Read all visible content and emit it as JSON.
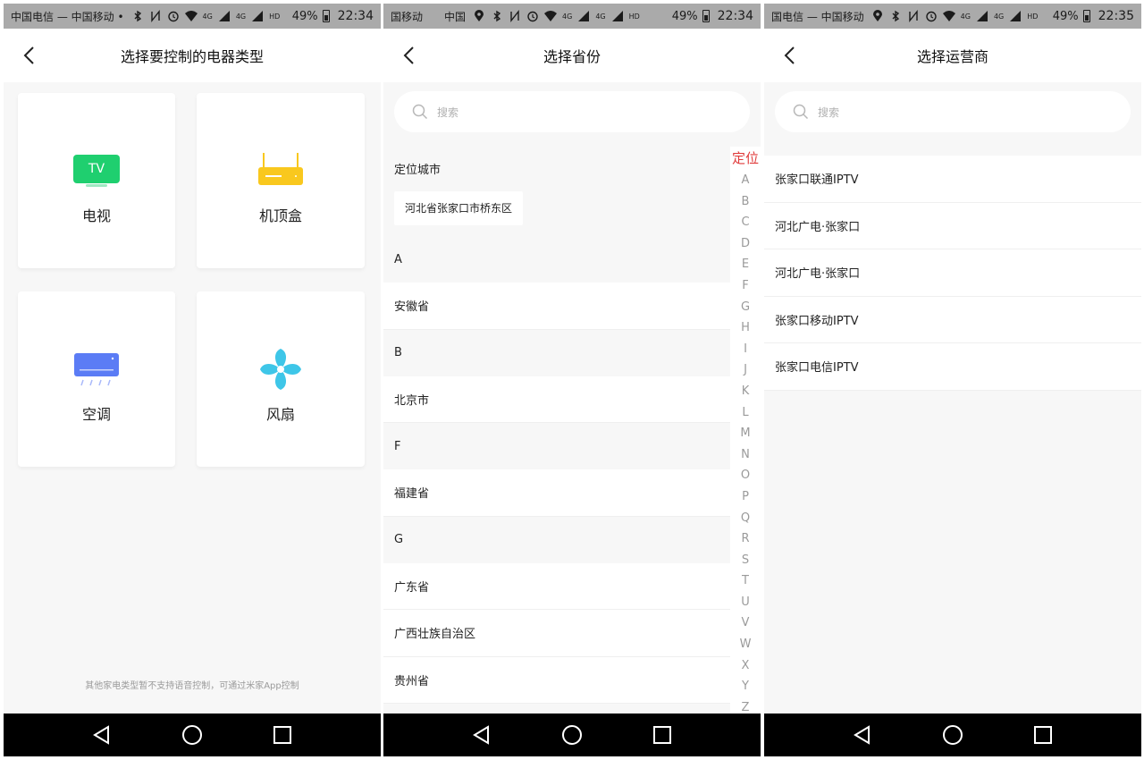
{
  "colors": {
    "statusbar_bg": "#aaaaaa",
    "tv_green": "#1fcf6f",
    "stb_yellow": "#f9c81e",
    "ac_blue": "#5b7cf5",
    "fan_cyan": "#3ec6e8",
    "index_red": "#e03c3c"
  },
  "panel1": {
    "status": {
      "carrier": "中国电信 — 中国移动 •",
      "net1": "4G",
      "net2": "4G",
      "hd": "HD",
      "battery": "49%",
      "time": "22:34"
    },
    "title": "选择要控制的电器类型",
    "cards": [
      {
        "label": "电视",
        "icon": "tv-icon",
        "badge": "TV"
      },
      {
        "label": "机顶盒",
        "icon": "set-top-box-icon"
      },
      {
        "label": "空调",
        "icon": "air-conditioner-icon"
      },
      {
        "label": "风扇",
        "icon": "fan-icon"
      }
    ],
    "footnote": "其他家电类型暂不支持语音控制，可通过米家App控制"
  },
  "panel2": {
    "status": {
      "carrier": "国移动　　中国",
      "net1": "4G",
      "net2": "4G",
      "hd": "HD",
      "battery": "49%",
      "time": "22:34"
    },
    "title": "选择省份",
    "search_placeholder": "搜索",
    "located_city_title": "定位城市",
    "located_city": "河北省张家口市桥东区",
    "sections": [
      {
        "letter": "A",
        "items": [
          "安徽省"
        ]
      },
      {
        "letter": "B",
        "items": [
          "北京市"
        ]
      },
      {
        "letter": "F",
        "items": [
          "福建省"
        ]
      },
      {
        "letter": "G",
        "items": [
          "广东省",
          "广西壮族自治区",
          "贵州省"
        ]
      }
    ],
    "index_locate": "定位",
    "index_letters": [
      "A",
      "B",
      "C",
      "D",
      "E",
      "F",
      "G",
      "H",
      "I",
      "J",
      "K",
      "L",
      "M",
      "N",
      "O",
      "P",
      "Q",
      "R",
      "S",
      "T",
      "U",
      "V",
      "W",
      "X",
      "Y",
      "Z"
    ]
  },
  "panel3": {
    "status": {
      "carrier": "国电信 — 中国移动",
      "net1": "4G",
      "net2": "4G",
      "hd": "HD",
      "battery": "49%",
      "time": "22:35"
    },
    "title": "选择运营商",
    "search_placeholder": "搜索",
    "operators": [
      "张家口联通IPTV",
      "河北广电·张家口",
      "河北广电·张家口",
      "张家口移动IPTV",
      "张家口电信IPTV"
    ]
  }
}
